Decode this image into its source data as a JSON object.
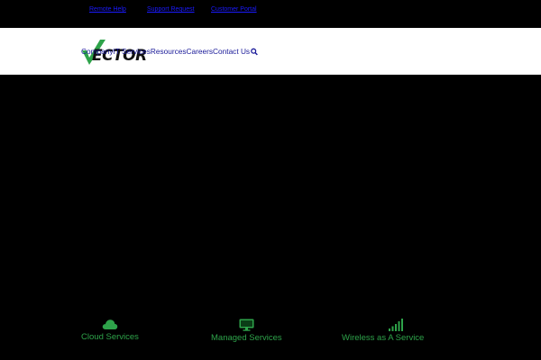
{
  "topbar": {
    "links": [
      "Remote Help",
      "Support Request",
      "Customer Portal"
    ]
  },
  "brand": {
    "logo_text": "ECTOR",
    "accent": "#2ea34a"
  },
  "nav": {
    "items": [
      "Company",
      "IT Services",
      "Resources",
      "Careers",
      "Contact Us"
    ],
    "search_icon": "search-icon",
    "color": "#1a1a99"
  },
  "services": [
    {
      "label": "Cloud Services",
      "icon": "cloud-icon"
    },
    {
      "label": "Managed Services",
      "icon": "monitor-icon"
    },
    {
      "label": "Wireless as A Service",
      "icon": "signal-bars-icon"
    }
  ]
}
